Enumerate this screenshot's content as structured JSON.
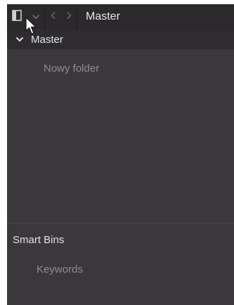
{
  "toolbar": {
    "toggle_icon": "panel-toggle-icon",
    "dropdown_icon": "chevron-down-icon",
    "back_icon": "chevron-left-icon",
    "forward_icon": "chevron-right-icon",
    "title": "Master"
  },
  "tree": {
    "root_label": "Master",
    "root_expanded": true,
    "items": [
      {
        "label": "Nowy folder"
      }
    ]
  },
  "smart_bins": {
    "header": "Smart Bins",
    "items": [
      {
        "label": "Keywords"
      }
    ]
  },
  "colors": {
    "panel_bg": "#3a383b",
    "toolbar_bg": "#2b292c",
    "text_primary": "#e6e6e6",
    "text_muted": "#8e8c8f"
  }
}
